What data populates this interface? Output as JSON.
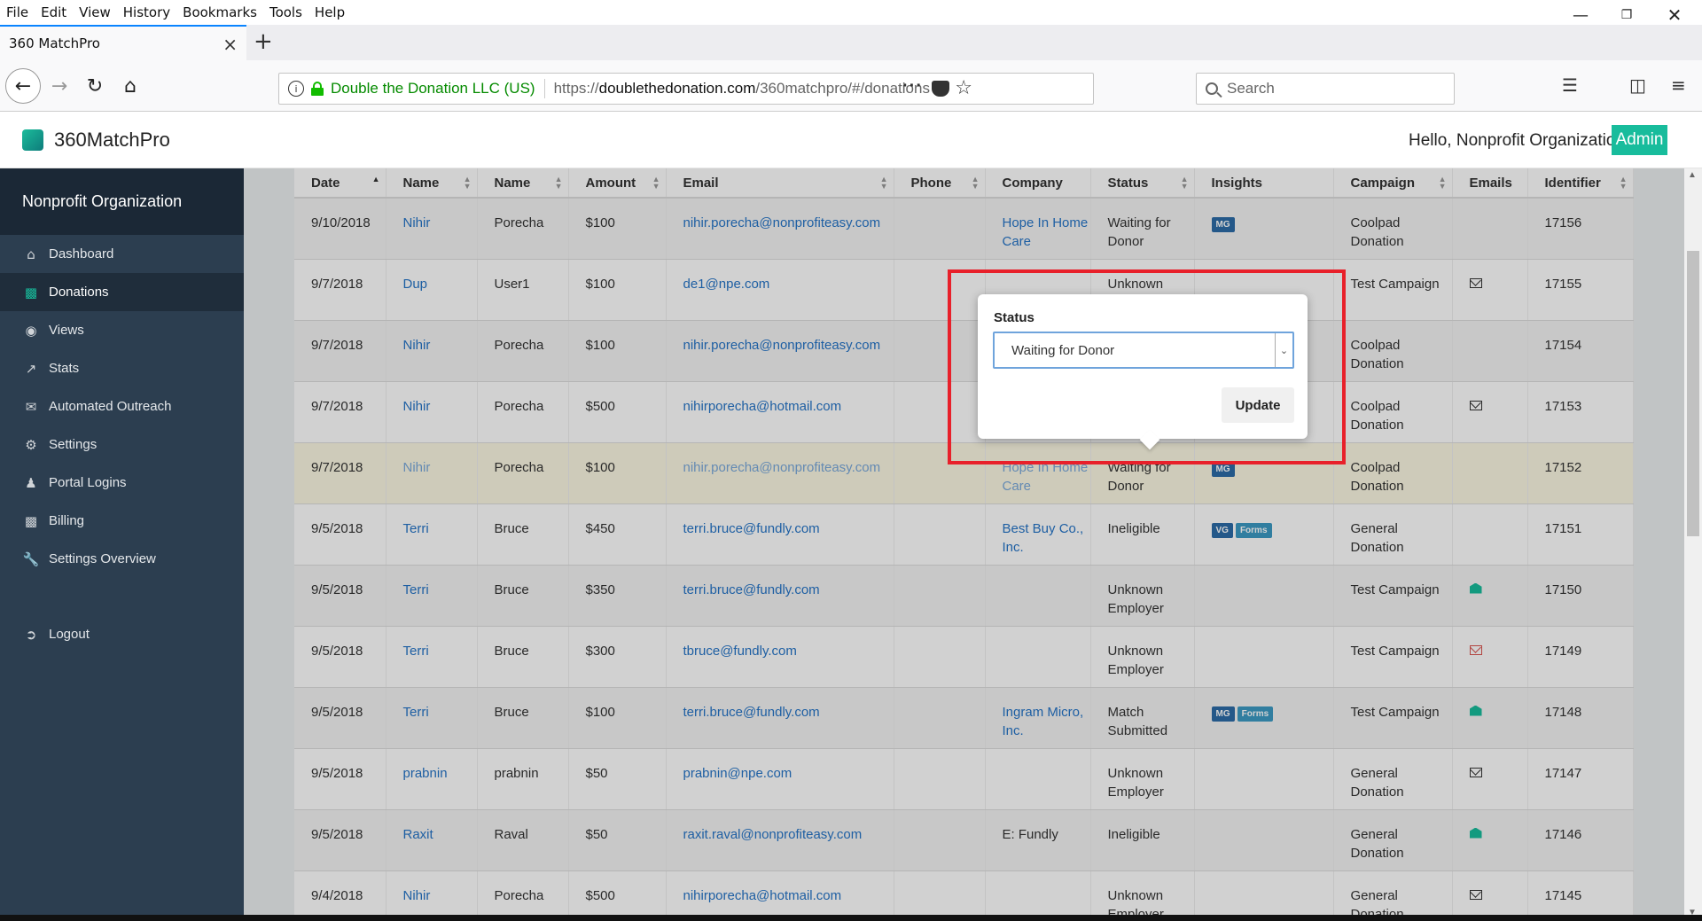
{
  "browser": {
    "menu": [
      "File",
      "Edit",
      "View",
      "History",
      "Bookmarks",
      "Tools",
      "Help"
    ],
    "tab_title": "360 MatchPro",
    "identity": "Double the Donation LLC (US)",
    "url_prefix": "https://",
    "url_domain": "doublethedonation.com",
    "url_path": "/360matchpro/#/donations",
    "search_placeholder": "Search"
  },
  "header": {
    "brand": "360MatchPro",
    "greeting": "Hello, Nonprofit Organization",
    "admin_label": "Admin"
  },
  "sidebar": {
    "org": "Nonprofit Organization",
    "items": [
      {
        "label": "Dashboard",
        "icon": "home-icon"
      },
      {
        "label": "Donations",
        "icon": "money-icon"
      },
      {
        "label": "Views",
        "icon": "eye-icon"
      },
      {
        "label": "Stats",
        "icon": "chart-icon"
      },
      {
        "label": "Automated Outreach",
        "icon": "envelope-icon"
      },
      {
        "label": "Settings",
        "icon": "gears-icon"
      },
      {
        "label": "Portal Logins",
        "icon": "user-icon"
      },
      {
        "label": "Billing",
        "icon": "money-icon"
      },
      {
        "label": "Settings Overview",
        "icon": "wrench-icon"
      }
    ],
    "logout": "Logout"
  },
  "table": {
    "columns": [
      "Date",
      "Name",
      "Name",
      "Amount",
      "Email",
      "Phone",
      "Company",
      "Status",
      "Insights",
      "Campaign",
      "Emails",
      "Identifier"
    ],
    "rows": [
      {
        "date": "9/10/2018",
        "first": "Nihir",
        "last": "Porecha",
        "amount": "$100",
        "email": "nihir.porecha@nonprofiteasy.com",
        "phone": "",
        "company": "Hope In Home Care",
        "status": "Waiting for Donor",
        "insights": [
          "MG"
        ],
        "campaign": "Coolpad Donation",
        "emails": "",
        "id": "17156"
      },
      {
        "date": "9/7/2018",
        "first": "Dup",
        "last": "User1",
        "amount": "$100",
        "email": "de1@npe.com",
        "phone": "",
        "company": "",
        "status": "Unknown",
        "insights": [],
        "campaign": "Test Campaign",
        "emails": "envelope",
        "id": "17155"
      },
      {
        "date": "9/7/2018",
        "first": "Nihir",
        "last": "Porecha",
        "amount": "$100",
        "email": "nihir.porecha@nonprofiteasy.com",
        "phone": "",
        "company": "",
        "status": "",
        "insights": [],
        "campaign": "Coolpad Donation",
        "emails": "",
        "id": "17154"
      },
      {
        "date": "9/7/2018",
        "first": "Nihir",
        "last": "Porecha",
        "amount": "$500",
        "email": "nihirporecha@hotmail.com",
        "phone": "",
        "company": "",
        "status": "",
        "insights": [],
        "campaign": "Coolpad Donation",
        "emails": "envelope",
        "id": "17153"
      },
      {
        "date": "9/7/2018",
        "first": "Nihir",
        "last": "Porecha",
        "amount": "$100",
        "email": "nihir.porecha@nonprofiteasy.com",
        "phone": "",
        "company": "Hope In Home Care",
        "status": "Waiting for Donor",
        "insights": [
          "MG"
        ],
        "campaign": "Coolpad Donation",
        "emails": "",
        "id": "17152"
      },
      {
        "date": "9/5/2018",
        "first": "Terri",
        "last": "Bruce",
        "amount": "$450",
        "email": "terri.bruce@fundly.com",
        "phone": "",
        "company": "Best Buy Co., Inc.",
        "status": "Ineligible",
        "insights": [
          "VG",
          "Forms"
        ],
        "campaign": "General Donation",
        "emails": "",
        "id": "17151"
      },
      {
        "date": "9/5/2018",
        "first": "Terri",
        "last": "Bruce",
        "amount": "$350",
        "email": "terri.bruce@fundly.com",
        "phone": "",
        "company": "",
        "status": "Unknown Employer",
        "insights": [],
        "campaign": "Test Campaign",
        "emails": "open",
        "id": "17150"
      },
      {
        "date": "9/5/2018",
        "first": "Terri",
        "last": "Bruce",
        "amount": "$300",
        "email": "tbruce@fundly.com",
        "phone": "",
        "company": "",
        "status": "Unknown Employer",
        "insights": [],
        "campaign": "Test Campaign",
        "emails": "red",
        "id": "17149"
      },
      {
        "date": "9/5/2018",
        "first": "Terri",
        "last": "Bruce",
        "amount": "$100",
        "email": "terri.bruce@fundly.com",
        "phone": "",
        "company": "Ingram Micro, Inc.",
        "status": "Match Submitted",
        "insights": [
          "MG",
          "Forms"
        ],
        "campaign": "Test Campaign",
        "emails": "open",
        "id": "17148"
      },
      {
        "date": "9/5/2018",
        "first": "prabnin",
        "last": "prabnin",
        "amount": "$50",
        "email": "prabnin@npe.com",
        "phone": "",
        "company": "",
        "status": "Unknown Employer",
        "insights": [],
        "campaign": "General Donation",
        "emails": "envelope",
        "id": "17147"
      },
      {
        "date": "9/5/2018",
        "first": "Raxit",
        "last": "Raval",
        "amount": "$50",
        "email": "raxit.raval@nonprofiteasy.com",
        "phone": "",
        "company": "E: Fundly",
        "status": "Ineligible",
        "insights": [],
        "campaign": "General Donation",
        "emails": "open",
        "id": "17146"
      },
      {
        "date": "9/4/2018",
        "first": "Nihir",
        "last": "Porecha",
        "amount": "$500",
        "email": "nihirporecha@hotmail.com",
        "phone": "",
        "company": "",
        "status": "Unknown Employer",
        "insights": [],
        "campaign": "General Donation",
        "emails": "envelope",
        "id": "17145"
      }
    ]
  },
  "popover": {
    "label": "Status",
    "selected": "Waiting for Donor",
    "update_label": "Update"
  }
}
